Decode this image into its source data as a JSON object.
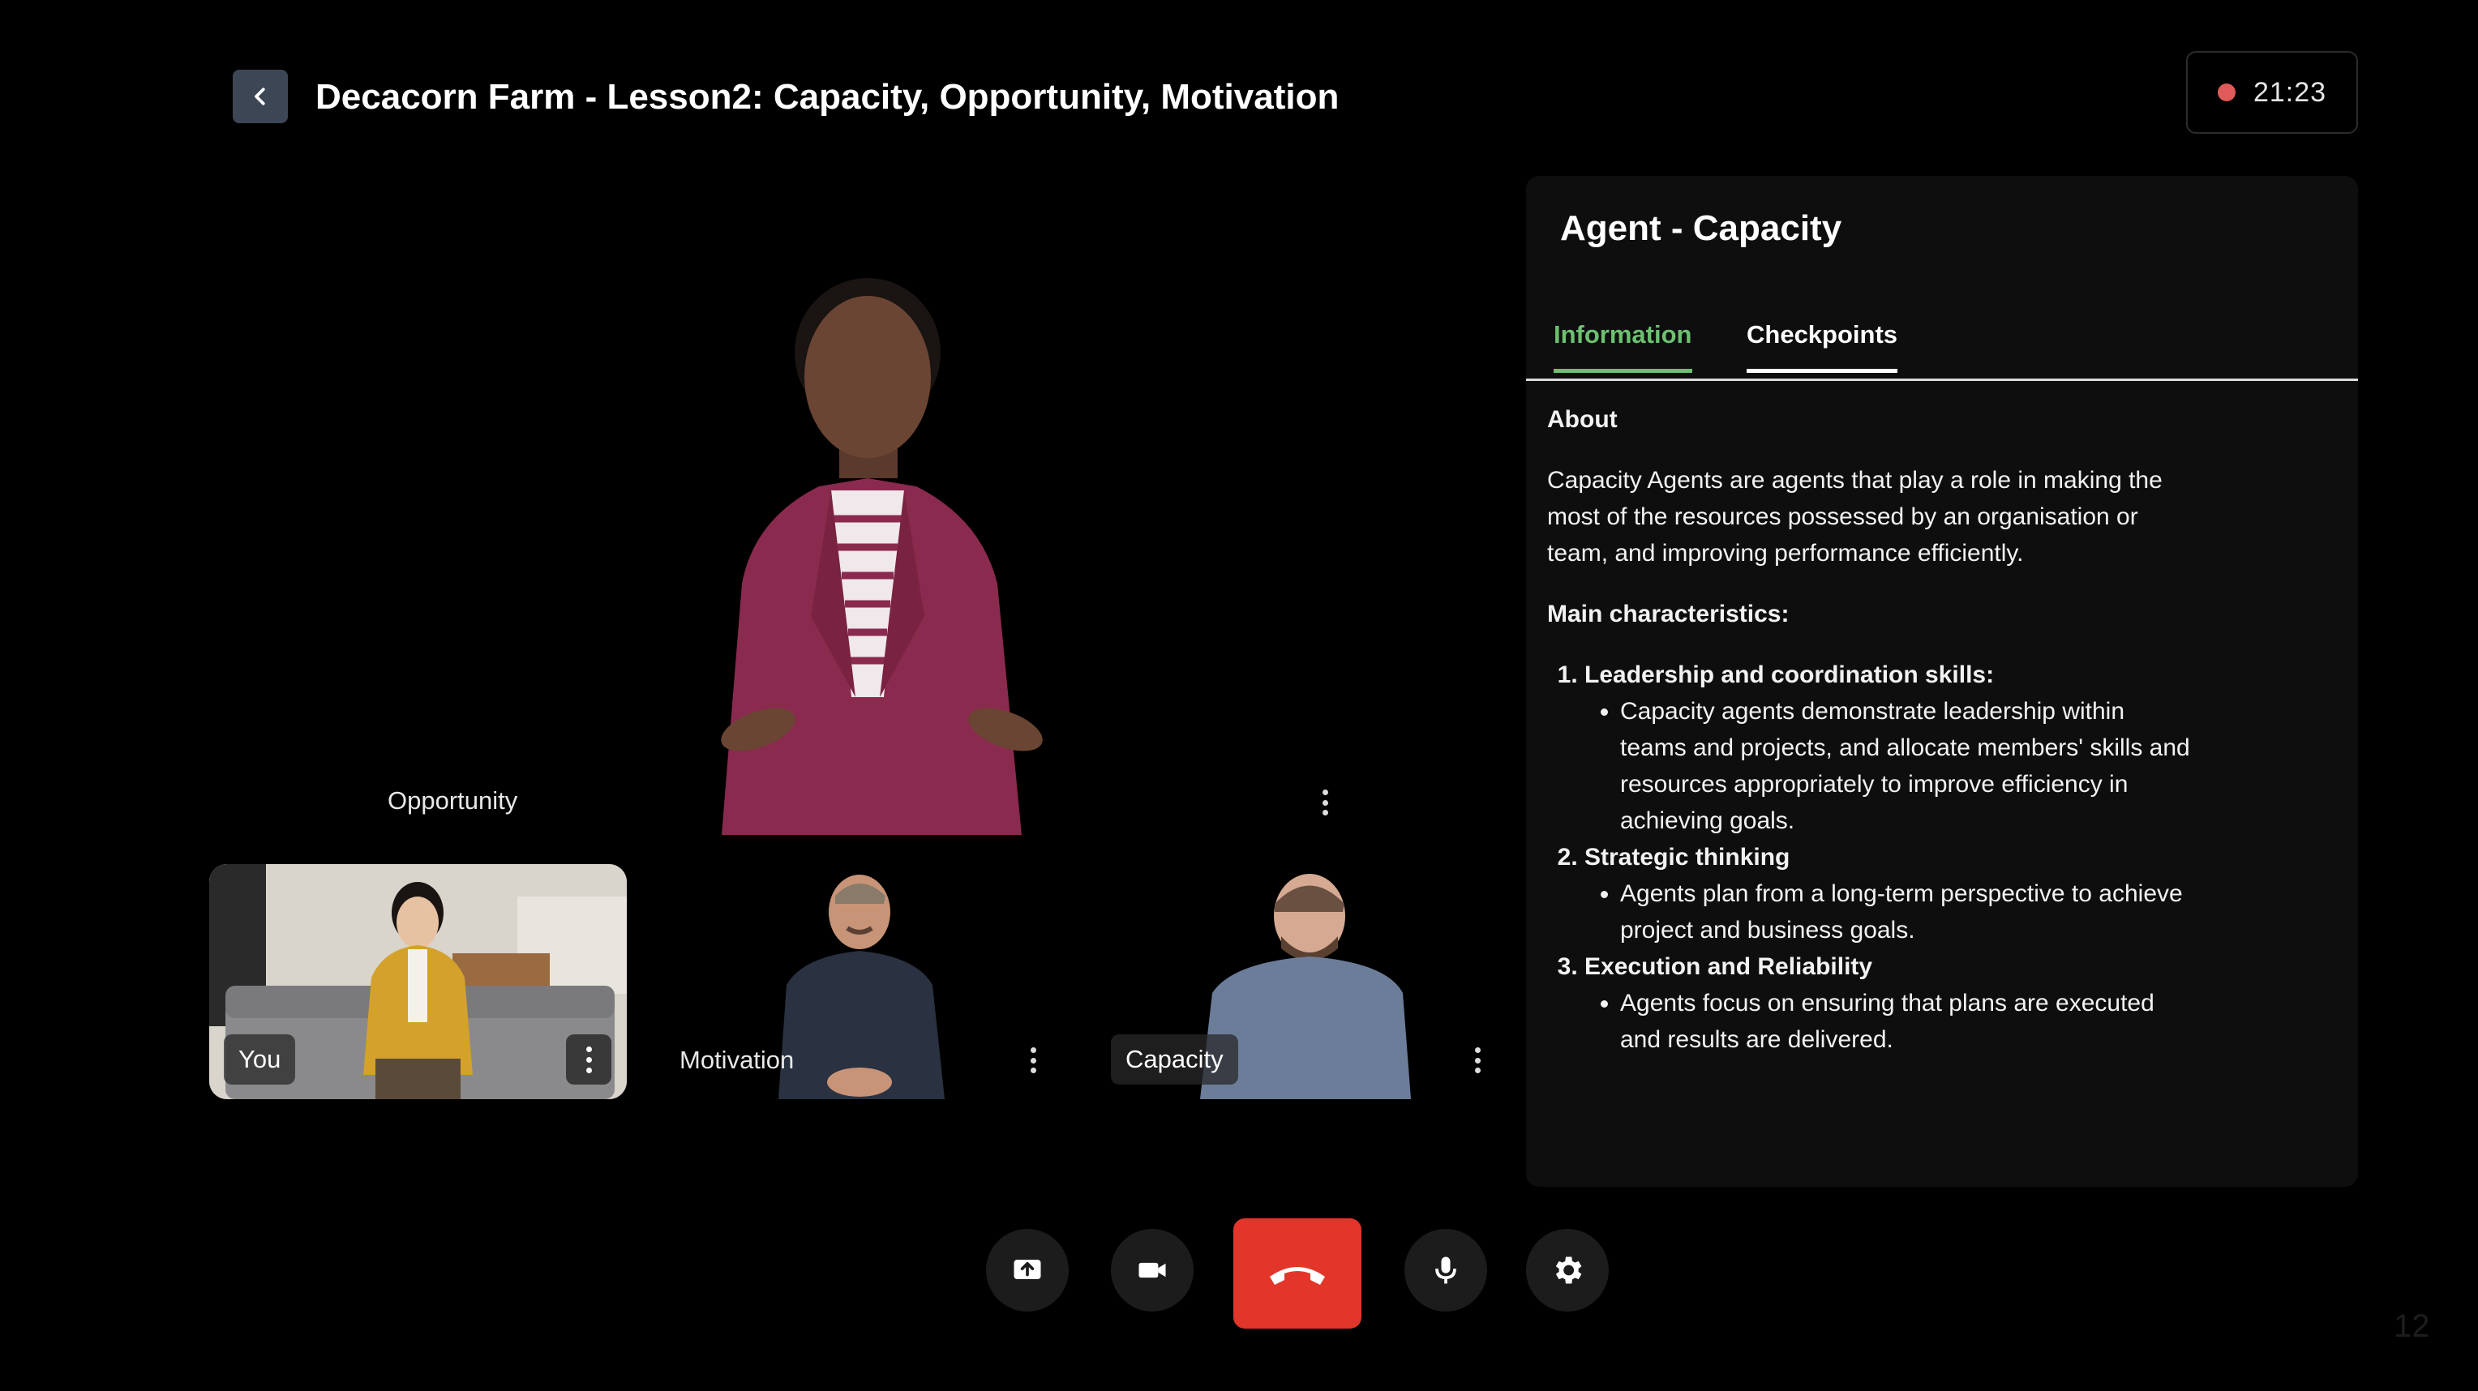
{
  "header": {
    "title": "Decacorn Farm - Lesson2: Capacity, Opportunity, Motivation",
    "timer": "21:23"
  },
  "stage": {
    "opportunity_label": "Opportunity"
  },
  "participants": {
    "you": "You",
    "motivation": "Motivation",
    "capacity": "Capacity"
  },
  "panel": {
    "title": "Agent - Capacity",
    "tabs": [
      "Information",
      "Checkpoints"
    ],
    "about_heading": "About",
    "about_text": "Capacity Agents are agents that play a role in making the most of the resources possessed by an organisation or team, and improving performance efficiently.",
    "characteristics_heading": "Main characteristics:",
    "items": [
      {
        "title": "Leadership and coordination skills:",
        "bullet": "Capacity agents demonstrate leadership within teams and projects, and allocate members' skills and resources appropriately to improve efficiency in achieving goals."
      },
      {
        "title": "Strategic thinking",
        "bullet": "Agents plan from a long-term perspective to achieve project and business goals."
      },
      {
        "title": "Execution and Reliability",
        "bullet": "Agents focus on ensuring that plans are executed and results are delivered."
      }
    ]
  },
  "controls": [
    "share-screen",
    "camera",
    "end-call",
    "microphone",
    "settings"
  ],
  "colors": {
    "accent": "#6cc070",
    "end_call": "#e2362b",
    "rec_dot": "#e05a5a"
  },
  "page_number": "12"
}
